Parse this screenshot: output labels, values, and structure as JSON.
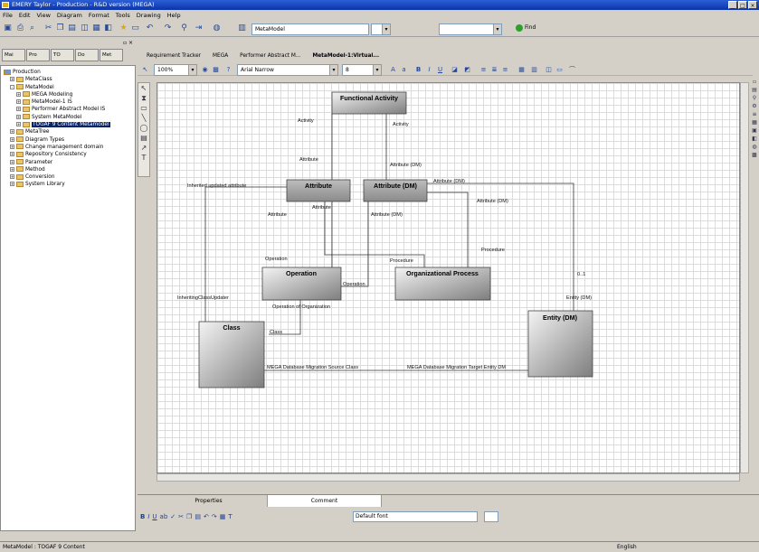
{
  "window": {
    "title": "EMERY Taylor - Production - R&D version (MEGA)"
  },
  "menu": [
    "File",
    "Edit",
    "View",
    "Diagram",
    "Format",
    "Tools",
    "Drawing",
    "Help"
  ],
  "toolbar": {
    "metamodel_combo": "MetaModel",
    "find_label": "Find"
  },
  "left_panel": {
    "tabs": [
      "Mai",
      "Pro",
      "TO",
      "Do",
      "Met"
    ],
    "tree": [
      {
        "label": "Production",
        "indent": 0,
        "expand": ""
      },
      {
        "label": "MetaClass",
        "indent": 1,
        "expand": "+"
      },
      {
        "label": "MetaModel",
        "indent": 1,
        "expand": "-"
      },
      {
        "label": "MEGA Modeling",
        "indent": 2,
        "expand": "+"
      },
      {
        "label": "MetaModel-1 IS",
        "indent": 2,
        "expand": "+"
      },
      {
        "label": "Performer Abstract Model IS",
        "indent": 2,
        "expand": "+"
      },
      {
        "label": "System MetaModel",
        "indent": 2,
        "expand": "+"
      },
      {
        "label": "TOGAF 9 Content Metamodel",
        "indent": 2,
        "expand": "+",
        "selected": true
      },
      {
        "label": "MetaTree",
        "indent": 1,
        "expand": "+"
      },
      {
        "label": "Diagram Types",
        "indent": 1,
        "expand": "+"
      },
      {
        "label": "Change management domain",
        "indent": 1,
        "expand": "+"
      },
      {
        "label": "Repository Consistency",
        "indent": 1,
        "expand": "+"
      },
      {
        "label": "Parameter",
        "indent": 1,
        "expand": "+"
      },
      {
        "label": "Method",
        "indent": 1,
        "expand": "+"
      },
      {
        "label": "Conversion",
        "indent": 1,
        "expand": "+"
      },
      {
        "label": "System Library",
        "indent": 1,
        "expand": "+"
      }
    ]
  },
  "doc_tabs": [
    "Requirement Tracker",
    "MEGA",
    "Performer Abstract M...",
    "MetaModel-1:Virtual..."
  ],
  "format_bar": {
    "zoom": "100%",
    "font": "Arial Narrow",
    "size": "8"
  },
  "diagram": {
    "boxes": {
      "functional_activity": "Functional Activity",
      "attribute": "Attribute",
      "attribute_dm": "Attribute (DM)",
      "operation": "Operation",
      "organizational_process": "Organizational Process",
      "class": "Class",
      "entity_dm": "Entity (DM)"
    },
    "labels": {
      "activity_left": "Activity",
      "activity_right": "Activity",
      "attribute_left": "Attribute",
      "attribute_dm_upper": "Attribute (DM)",
      "attribute_dm_right": "Attribute (DM)",
      "attribute_dm_right2": "Attribute (DM)",
      "inherited": "Inherited updated attribute",
      "attribute_lower": "Attribute",
      "attribute_below": "Attribute",
      "attribute_dm_below": "Attribute (DM)",
      "procedure_left": "Procedure",
      "procedure_right": "Procedure",
      "operation_label": "Operation",
      "operation_small": "Operation",
      "multiplicity": "0..1",
      "entity_dm_label": "Entity (DM)",
      "inheriting": "InheritingClassUpdater",
      "op_of_org": "Operation of Organization",
      "class_label": "Class",
      "src_class": "MEGA Database Migration Source Class",
      "tgt_entity": "MEGA Database Migration Target Entity DM"
    }
  },
  "bottom_panel": {
    "tabs": [
      "Properties",
      "Comment"
    ],
    "font_combo": "Default font"
  },
  "status": {
    "path": "MetaModel : TOGAF 9 Content",
    "language": "English"
  }
}
